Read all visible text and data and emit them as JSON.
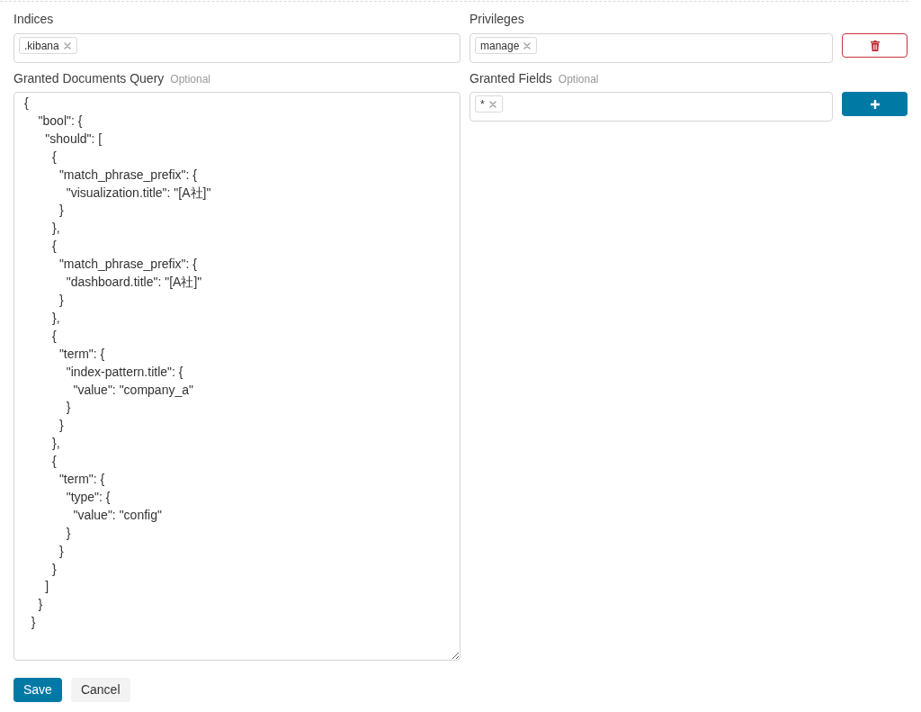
{
  "indices": {
    "label": "Indices",
    "tags": [
      {
        "label": ".kibana"
      }
    ]
  },
  "privileges": {
    "label": "Privileges",
    "tags": [
      {
        "label": "manage"
      }
    ]
  },
  "granted_documents_query": {
    "label": "Granted Documents Query",
    "optional_label": "Optional",
    "value": "{\n    \"bool\": {\n      \"should\": [\n        {\n          \"match_phrase_prefix\": {\n            \"visualization.title\": \"[A社]\"\n          }\n        },\n        {\n          \"match_phrase_prefix\": {\n            \"dashboard.title\": \"[A社]\"\n          }\n        },\n        {\n          \"term\": {\n            \"index-pattern.title\": {\n              \"value\": \"company_a\"\n            }\n          }\n        },\n        {\n          \"term\": {\n            \"type\": {\n              \"value\": \"config\"\n            }\n          }\n        }\n      ]\n    }\n  }"
  },
  "granted_fields": {
    "label": "Granted Fields",
    "optional_label": "Optional",
    "tags": [
      {
        "label": "*"
      }
    ]
  },
  "buttons": [
    {
      "label": "Save",
      "kind": "primary"
    },
    {
      "label": "Cancel",
      "kind": "secondary"
    }
  ]
}
